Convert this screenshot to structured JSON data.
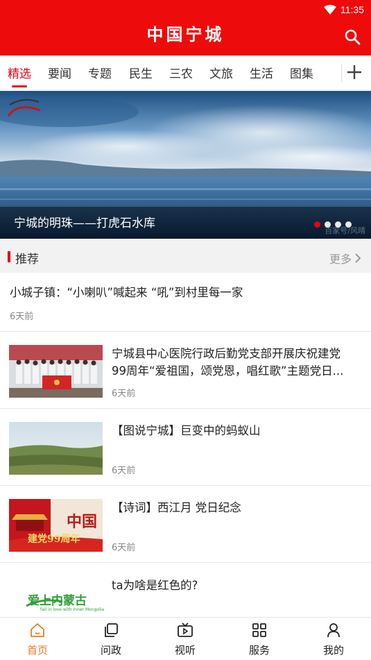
{
  "status": {
    "time": "11:35"
  },
  "header": {
    "title": "中国宁城"
  },
  "tabs": [
    {
      "label": "精选",
      "active": true
    },
    {
      "label": "要闻"
    },
    {
      "label": "专题"
    },
    {
      "label": "民生"
    },
    {
      "label": "三农"
    },
    {
      "label": "文旅"
    },
    {
      "label": "生活"
    },
    {
      "label": "图集"
    }
  ],
  "banner": {
    "caption": "宁城的明珠——打虎石水库",
    "watermark": "百家号/风晴",
    "slides_total": 4,
    "slide_active": 1
  },
  "section": {
    "title": "推荐",
    "more_label": "更多"
  },
  "articles": [
    {
      "title": "小城子镇：“小喇叭”喊起来 “吼”到村里每一家",
      "time": "6天前",
      "thumbnail": "none"
    },
    {
      "title_line1": "宁城县中心医院行政后勤党支部开展庆祝建党",
      "title_line2": "99周年“爱祖国，颂党恩，唱红歌”主题党日...",
      "time": "6天前",
      "thumbnail": "group-photo"
    },
    {
      "title": "【图说宁城】巨变中的蚂蚁山",
      "time": "6天前",
      "thumbnail": "landscape"
    },
    {
      "title": "【诗词】西江月 党日纪念",
      "time": "6天前",
      "thumbnail": "party-anniversary",
      "thumb_text_top": "中国",
      "thumb_text_bottom": "建党99周年"
    },
    {
      "title": "ta为啥是红色的?",
      "time": "",
      "thumbnail": "logo",
      "thumb_text": "爱上内蒙古",
      "thumb_subtext": "fall in love with Inner Mongolia"
    }
  ],
  "bottom_nav": [
    {
      "label": "首页",
      "icon": "home-icon",
      "active": true
    },
    {
      "label": "问政",
      "icon": "copy-icon"
    },
    {
      "label": "视听",
      "icon": "tv-play-icon"
    },
    {
      "label": "服务",
      "icon": "grid-icon"
    },
    {
      "label": "我的",
      "icon": "user-icon"
    }
  ],
  "colors": {
    "brand_red": "#ee0b0b",
    "accent_red": "#e60012",
    "nav_active": "#e97c1e"
  }
}
